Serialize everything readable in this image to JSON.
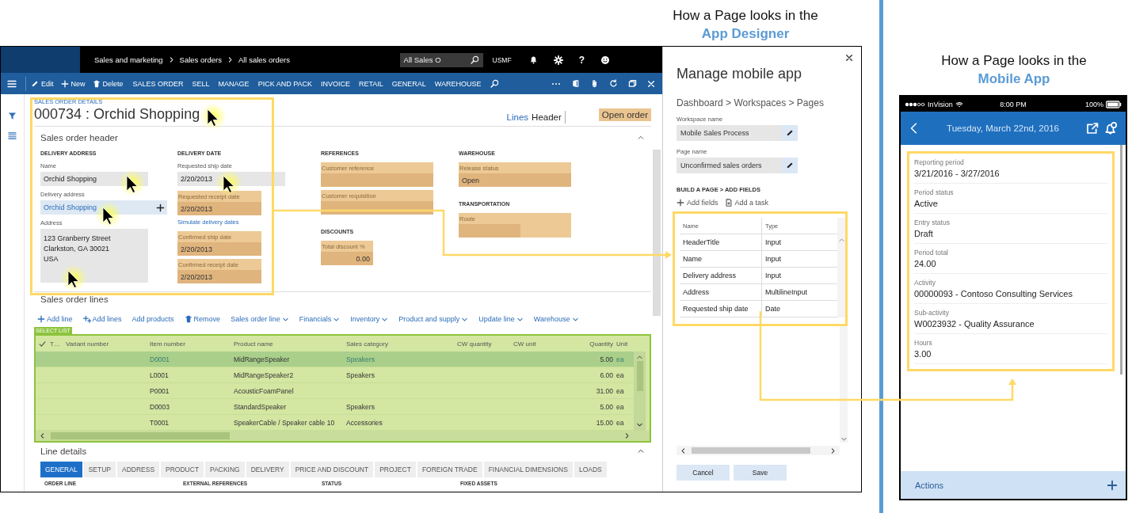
{
  "designer_caption": {
    "line_1": "How a Page looks in the",
    "line_2": "App Designer"
  },
  "erp": {
    "nav_bar": {
      "breadcrumbs": [
        "Sales and marketing",
        "Sales orders",
        "All sales orders"
      ],
      "search": {
        "value": "All Sales O"
      },
      "company": "USMF",
      "help": "?"
    },
    "action_bar": {
      "commands": [
        {
          "label": "Edit",
          "kind": "edit"
        },
        {
          "label": "New",
          "kind": "new"
        },
        {
          "label": "Delete",
          "kind": "delete"
        }
      ],
      "menus": [
        "SALES ORDER",
        "SELL",
        "MANAGE",
        "PICK AND PACK",
        "INVOICE",
        "RETAIL",
        "GENERAL",
        "WAREHOUSE"
      ]
    },
    "page_header": {
      "caption": "SALES ORDER DETAILS",
      "title": "000734 : Orchid Shopping",
      "views": [
        {
          "label": "Lines",
          "selected": false
        },
        {
          "label": "Header",
          "selected": true
        }
      ],
      "status": "Open order"
    },
    "header_section": {
      "title": "Sales order header",
      "columns": [
        {
          "groups": [
            {
              "heading": "DELIVERY ADDRESS",
              "fields": [
                {
                  "kind": "input",
                  "label": "Name",
                  "value": "Orchid Shopping"
                },
                {
                  "kind": "lookup",
                  "label": "Delivery address",
                  "value": "Orchid Shopping"
                },
                {
                  "kind": "multiline",
                  "label": "Address",
                  "value": "123 Granberry Street\nClarkston, GA 30021\nUSA"
                }
              ]
            }
          ]
        },
        {
          "groups": [
            {
              "heading": "DELIVERY DATE",
              "fields": [
                {
                  "kind": "input",
                  "label": "Requested ship date",
                  "value": "2/20/2013"
                },
                {
                  "kind": "readonly",
                  "label": "Requested receipt date",
                  "value": "2/20/2013"
                },
                {
                  "kind": "link",
                  "label": "Simulate delivery dates"
                },
                {
                  "kind": "readonly",
                  "label": "Confirmed ship date",
                  "value": "2/20/2013"
                },
                {
                  "kind": "readonly",
                  "label": "Confirmed receipt date",
                  "value": "2/20/2013"
                }
              ]
            }
          ]
        },
        {
          "groups": [
            {
              "heading": "REFERENCES",
              "fields": [
                {
                  "kind": "readonly",
                  "label": "Customer reference"
                },
                {
                  "kind": "readonly",
                  "label": "Customer requisition"
                }
              ]
            },
            {
              "heading": "DISCOUNTS",
              "fields": [
                {
                  "kind": "readonly",
                  "label": "Total discount %",
                  "value": "0.00"
                }
              ]
            }
          ]
        },
        {
          "groups": [
            {
              "heading": "WAREHOUSE",
              "fields": [
                {
                  "kind": "readonly",
                  "label": "Release status",
                  "value": "Open"
                }
              ]
            },
            {
              "heading": "TRANSPORTATION",
              "fields": [
                {
                  "kind": "readonly",
                  "label": "Route"
                }
              ]
            }
          ]
        }
      ]
    },
    "lines_section": {
      "title": "Sales order lines",
      "toolbar": [
        {
          "label": "Add line",
          "kind": "add"
        },
        {
          "label": "Add lines",
          "kind": "add_multiple"
        },
        {
          "label": "Add products",
          "kind": "plain"
        },
        {
          "label": "Remove",
          "kind": "remove"
        },
        {
          "label": "Sales order line",
          "kind": "menu"
        },
        {
          "label": "Financials",
          "kind": "menu"
        },
        {
          "label": "Inventory",
          "kind": "menu"
        },
        {
          "label": "Product and supply",
          "kind": "menu"
        },
        {
          "label": "Update line",
          "kind": "menu"
        },
        {
          "label": "Warehouse",
          "kind": "menu"
        }
      ],
      "grid": {
        "badge": "SELECT LIST",
        "columns": [
          "T…",
          "Variant number",
          "Item number",
          "Product name",
          "Sales category",
          "CW quantity",
          "CW unit",
          "Quantity",
          "Unit"
        ],
        "rows": [
          {
            "item": "D0001",
            "product": "MidRangeSpeaker",
            "category": "Speakers",
            "quantity": "5.00",
            "unit": "ea",
            "selected": true
          },
          {
            "item": "L0001",
            "product": "MidRangeSpeaker2",
            "category": "Speakers",
            "quantity": "6.00",
            "unit": "ea",
            "selected": false
          },
          {
            "item": "P0001",
            "product": "AcousticFoamPanel",
            "quantity": "31.00",
            "unit": "ea",
            "selected": false
          },
          {
            "item": "D0003",
            "product": "StandardSpeaker",
            "category": "Speakers",
            "quantity": "5.00",
            "unit": "ea",
            "selected": false
          },
          {
            "item": "T0001",
            "product": "SpeakerCable / Speaker cable 10",
            "category": "Accessories",
            "quantity": "15.00",
            "unit": "ea",
            "selected": false
          }
        ]
      }
    },
    "line_details": {
      "title": "Line details",
      "tabs": [
        {
          "label": "GENERAL",
          "selected": true
        },
        {
          "label": "SETUP",
          "selected": false
        },
        {
          "label": "ADDRESS",
          "selected": false
        },
        {
          "label": "PRODUCT",
          "selected": false
        },
        {
          "label": "PACKING",
          "selected": false
        },
        {
          "label": "DELIVERY",
          "selected": false
        },
        {
          "label": "PRICE AND DISCOUNT",
          "selected": false
        },
        {
          "label": "PROJECT",
          "selected": false
        },
        {
          "label": "FOREIGN TRADE",
          "selected": false
        },
        {
          "label": "FINANCIAL DIMENSIONS",
          "selected": false
        },
        {
          "label": "LOADS",
          "selected": false
        }
      ],
      "group_headings": [
        "ORDER LINE",
        "EXTERNAL REFERENCES",
        "STATUS",
        "FIXED ASSETS"
      ]
    }
  },
  "designer": {
    "title": "Manage mobile app",
    "breadcrumb": "Dashboard > Workspaces > Pages",
    "fields": [
      {
        "label": "Workspace name",
        "value": "Mobile Sales Process"
      },
      {
        "label": "Page name",
        "value": "Unconfirmed sales orders"
      }
    ],
    "section_heading": "BUILD A PAGE > ADD FIELDS",
    "actions": [
      {
        "label": "Add fields",
        "kind": "add"
      },
      {
        "label": "Add a task",
        "kind": "task"
      }
    ],
    "table": {
      "columns": [
        "Name",
        "Type"
      ],
      "rows": [
        {
          "name": "HeaderTitle",
          "type": "Input"
        },
        {
          "name": "Name",
          "type": "Input"
        },
        {
          "name": "Delivery address",
          "type": "Input"
        },
        {
          "name": "Address",
          "type": "MultilineInput"
        },
        {
          "name": "Requested ship date",
          "type": "Date"
        }
      ]
    },
    "buttons": [
      "Cancel",
      "Save"
    ]
  },
  "mobile_caption": {
    "line_1": "How a Page looks in the",
    "line_2": "Mobile App"
  },
  "phone": {
    "status_bar": {
      "carrier": "InVision",
      "time": "8:00 PM",
      "battery": "100%"
    },
    "header": {
      "title": "Tuesday, March 22nd, 2016"
    },
    "fields": [
      {
        "label": "Reporting period",
        "value": "3/21/2016 - 3/27/2016"
      },
      {
        "label": "Period status",
        "value": "Active"
      },
      {
        "label": "Entry status",
        "value": "Draft"
      },
      {
        "label": "Period total",
        "value": "24.00"
      },
      {
        "label": "Activity",
        "value": "00000093 - Contoso Consulting Services"
      },
      {
        "label": "Sub-activity",
        "value": "W0023932 - Quality Assurance"
      },
      {
        "label": "Hours",
        "value": "3.00"
      }
    ],
    "actions": "Actions"
  }
}
